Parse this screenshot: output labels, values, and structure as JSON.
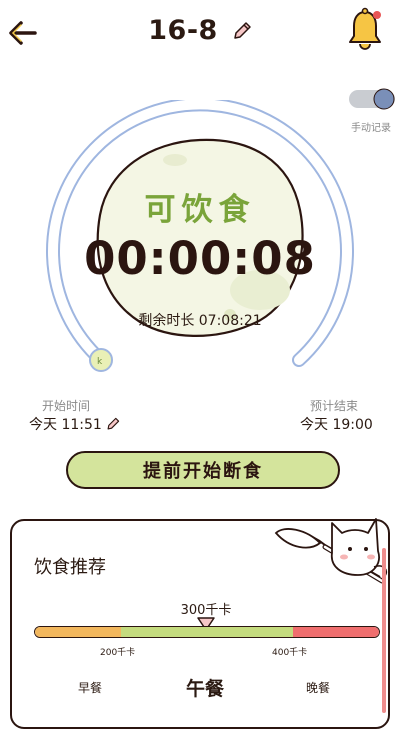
{
  "header": {
    "title": "16-8"
  },
  "toggle": {
    "label": "手动记录"
  },
  "status": {
    "text": "可饮食",
    "timer": "00:00:08",
    "remaining": "剩余时长 07:08:21"
  },
  "start": {
    "label": "开始时间",
    "value": "今天 11:51"
  },
  "end": {
    "label": "预计结束",
    "value": "今天 19:00"
  },
  "action": {
    "label": "提前开始断食"
  },
  "recommend": {
    "title": "饮食推荐",
    "kcal": "300千卡",
    "min_label": "200千卡",
    "max_label": "400千卡",
    "meals": [
      "早餐",
      "午餐",
      "晚餐"
    ]
  },
  "colors": {
    "accent": "#7aa43a",
    "ring": "#9fb6e0",
    "button": "#d4e49c",
    "danger": "#ef6e6e",
    "warn": "#f2b75d"
  }
}
